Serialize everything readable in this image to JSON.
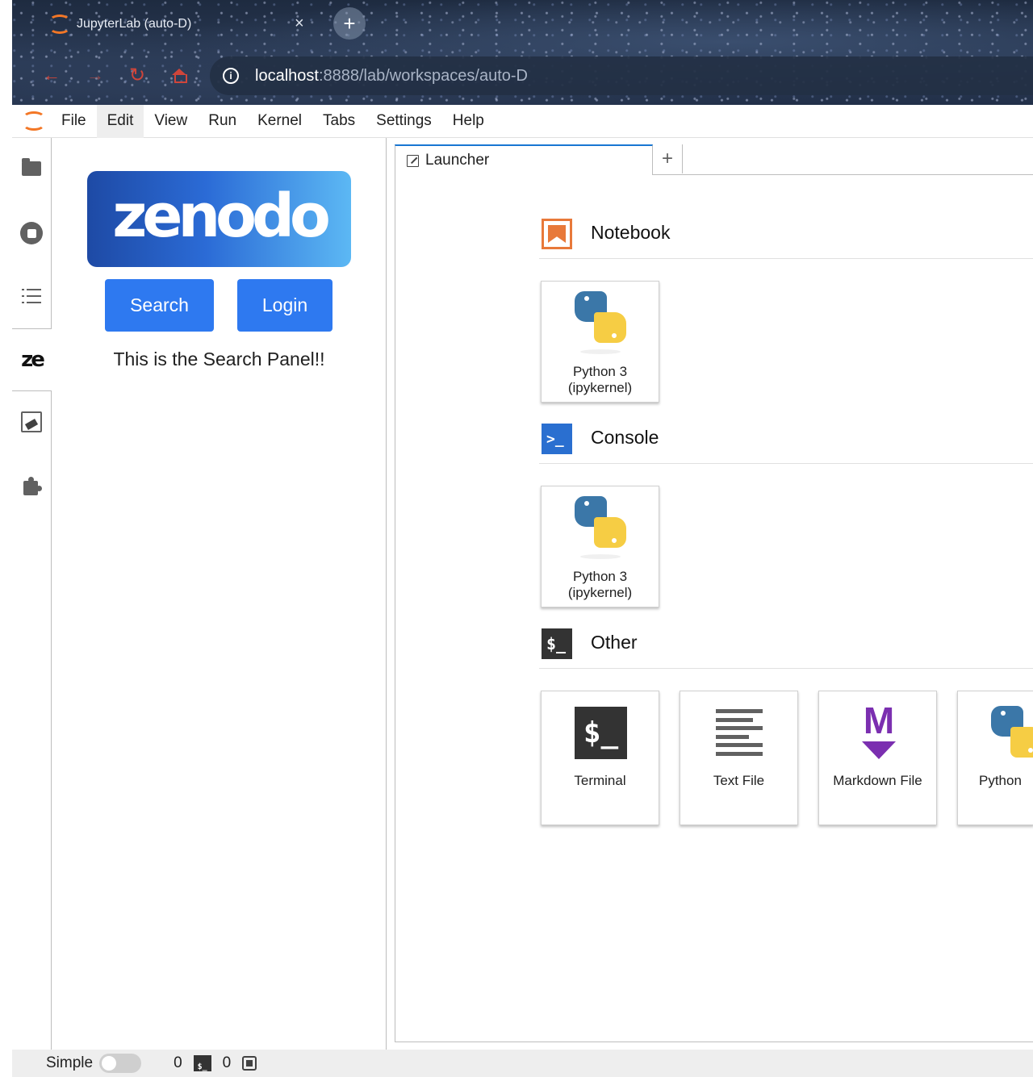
{
  "browser": {
    "tab_title": "JupyterLab (auto-D)",
    "tab_close": "×",
    "new_tab": "+",
    "url_host": "localhost",
    "url_path": ":8888/lab/workspaces/auto-D",
    "info_glyph": "i",
    "back_glyph": "←",
    "forward_glyph": "→",
    "reload_glyph": "↻"
  },
  "menu": {
    "items": [
      "File",
      "Edit",
      "View",
      "Run",
      "Kernel",
      "Tabs",
      "Settings",
      "Help"
    ]
  },
  "sidebar": {
    "zenodo_label": "ze"
  },
  "zenodo_panel": {
    "logo_text": "zenodo",
    "search_label": "Search",
    "login_label": "Login",
    "message": "This is the Search Panel!!"
  },
  "launcher": {
    "tab_label": "Launcher",
    "add_tab": "+",
    "sections": {
      "notebook": {
        "title": "Notebook",
        "card_label_1": "Python 3",
        "card_label_2": "(ipykernel)"
      },
      "console": {
        "title": "Console",
        "icon_text": ">_",
        "card_label_1": "Python 3",
        "card_label_2": "(ipykernel)"
      },
      "other": {
        "title": "Other",
        "icon_text": "$_",
        "cards": [
          "Terminal",
          "Text File",
          "Markdown File",
          "Python"
        ],
        "terminal_glyph": "$_",
        "markdown_glyph": "M"
      }
    }
  },
  "statusbar": {
    "simple_label": "Simple",
    "terminal_count": "0",
    "terminal_icon_text": "$_",
    "kernel_count": "0"
  },
  "colors": {
    "accent": "#1976d2",
    "button_blue": "#2e79f0",
    "jupyter_orange": "#f37726",
    "notebook_orange": "#e8793a",
    "console_blue": "#2a6fd0",
    "markdown_purple": "#7b2fb0"
  },
  "icons": {
    "sidebar": [
      "folder-icon",
      "running-icon",
      "toc-icon",
      "zenodo-icon",
      "cleaner-icon",
      "extension-icon"
    ]
  }
}
